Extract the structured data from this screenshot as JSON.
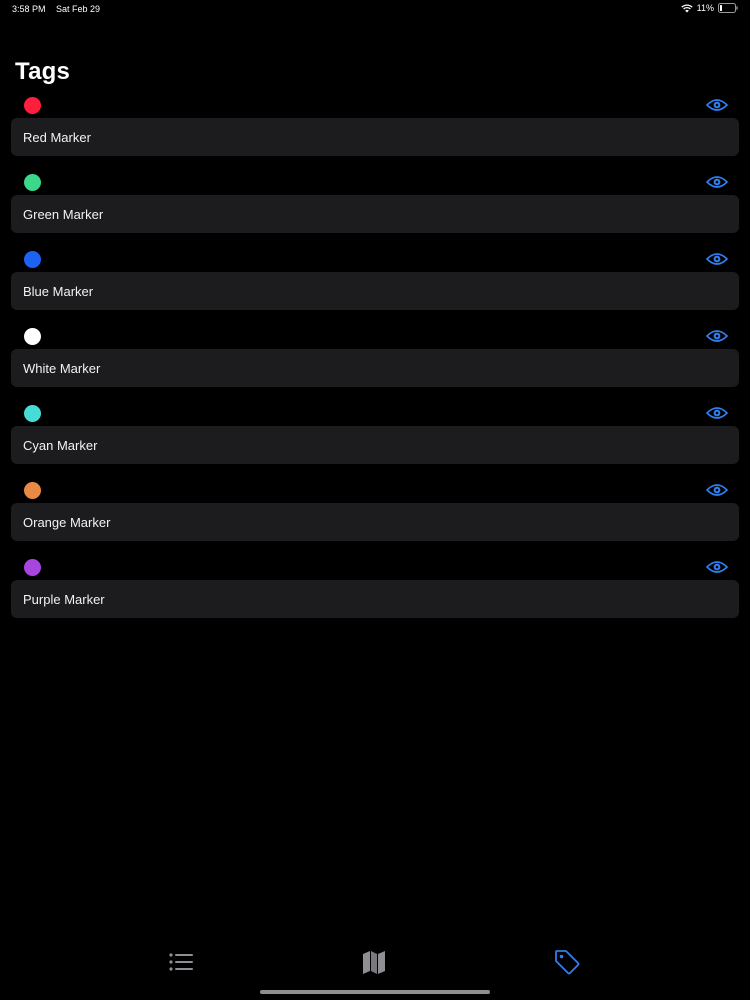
{
  "status_bar": {
    "time": "3:58 PM",
    "date": "Sat Feb 29",
    "battery": "11%",
    "icons": [
      "wifi-icon",
      "battery-icon"
    ]
  },
  "page": {
    "title": "Tags"
  },
  "tags": [
    {
      "name": "Red Marker",
      "color": "#ff1f3d",
      "visibility_icon": "eye-icon"
    },
    {
      "name": "Green Marker",
      "color": "#3ad88a",
      "visibility_icon": "eye-icon"
    },
    {
      "name": "Blue Marker",
      "color": "#1e62f2",
      "visibility_icon": "eye-icon"
    },
    {
      "name": "White Marker",
      "color": "#ffffff",
      "visibility_icon": "eye-icon"
    },
    {
      "name": "Cyan Marker",
      "color": "#46ddd6",
      "visibility_icon": "eye-icon"
    },
    {
      "name": "Orange Marker",
      "color": "#e88a43",
      "visibility_icon": "eye-icon"
    },
    {
      "name": "Purple Marker",
      "color": "#a845de",
      "visibility_icon": "eye-icon"
    }
  ],
  "tab_bar": {
    "tabs": [
      {
        "icon": "list-icon",
        "selected": false
      },
      {
        "icon": "map-icon",
        "selected": false
      },
      {
        "icon": "tag-icon",
        "selected": true
      }
    ]
  },
  "colors": {
    "accent": "#2f7ff0",
    "tab_inactive": "#8e8e93",
    "field_background": "#1c1c1e",
    "background": "#000000"
  }
}
